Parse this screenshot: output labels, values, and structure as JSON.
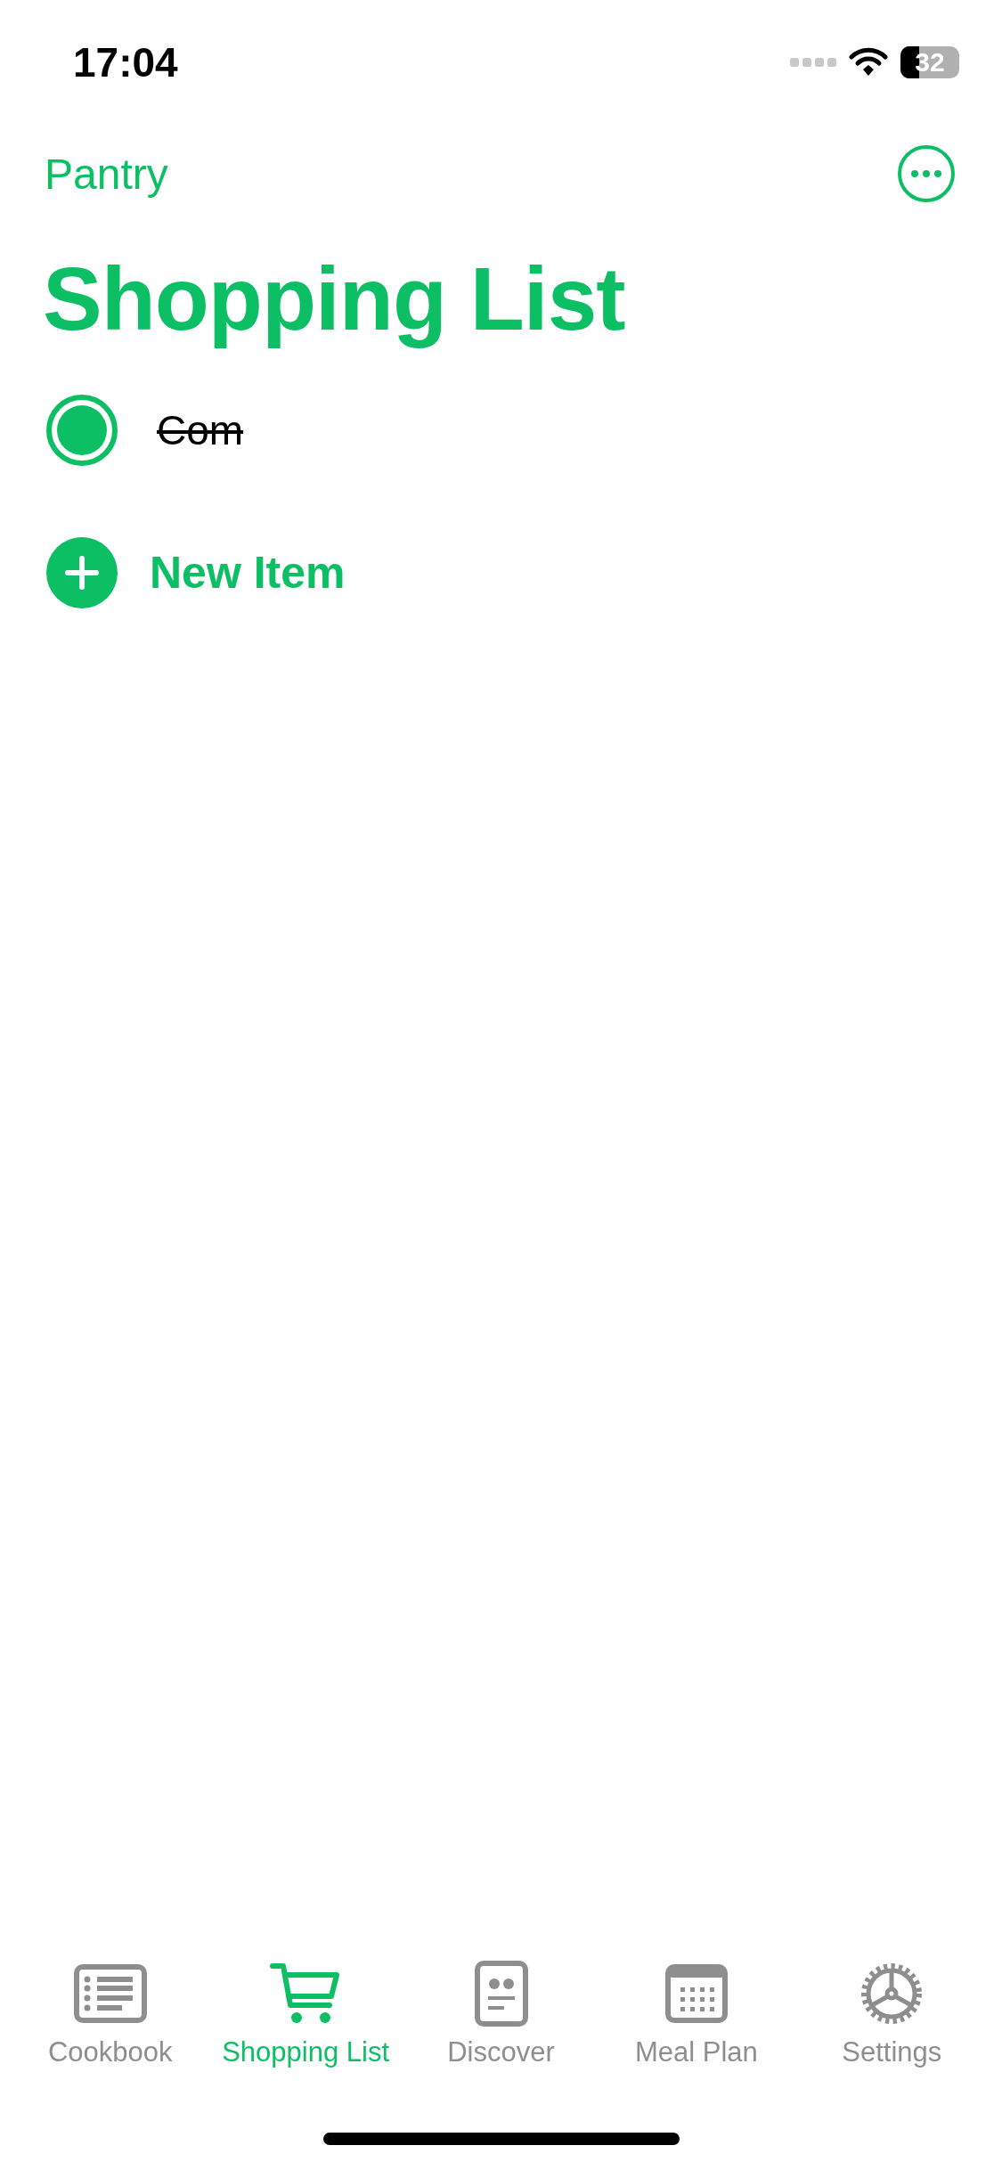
{
  "status_bar": {
    "time": "17:04",
    "battery": "32"
  },
  "nav": {
    "back": "Pantry"
  },
  "title": "Shopping List",
  "items": [
    {
      "name": "Com",
      "checked": true
    }
  ],
  "new_item": "New Item",
  "tabs": [
    {
      "label": "Cookbook",
      "selected": false
    },
    {
      "label": "Shopping List",
      "selected": true
    },
    {
      "label": "Discover",
      "selected": false
    },
    {
      "label": "Meal Plan",
      "selected": false
    },
    {
      "label": "Settings",
      "selected": false
    }
  ]
}
